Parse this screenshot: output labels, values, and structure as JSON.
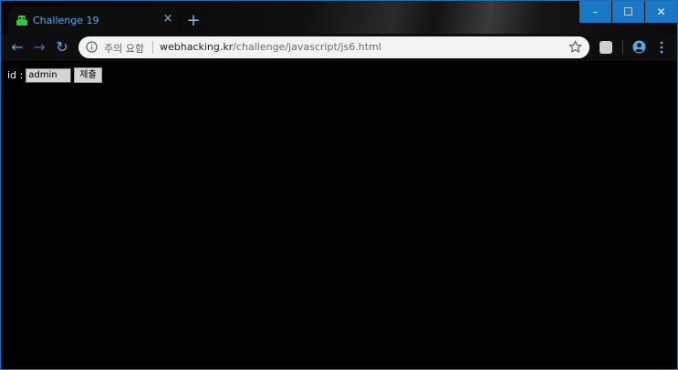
{
  "browser": {
    "tab": {
      "title": "Challenge 19",
      "close_glyph": "×"
    },
    "new_tab_glyph": "+",
    "window_controls": {
      "minimize": "–",
      "maximize": "☐",
      "close": "✕"
    },
    "nav": {
      "back": "←",
      "forward": "→",
      "reload": "↻"
    },
    "address_bar": {
      "security_label": "주의 요함",
      "url_host": "webhacking.kr",
      "url_path": "/challenge/javascript/js6.html"
    },
    "colors": {
      "accent": "#5aa7e8",
      "window_controls": "#1a78c6",
      "favicon": "#2ecc40"
    }
  },
  "page": {
    "id_label": "id :",
    "id_input_value": "admin",
    "submit_label": "제출"
  }
}
